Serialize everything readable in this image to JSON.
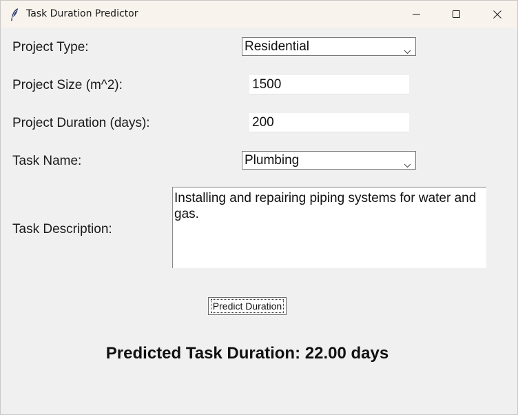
{
  "window": {
    "title": "Task Duration Predictor",
    "controls": [
      "minimize-icon",
      "maximize-icon",
      "close-icon"
    ]
  },
  "form": {
    "project_type": {
      "label": "Project Type:",
      "value": "Residential"
    },
    "project_size": {
      "label": "Project Size (m^2):",
      "value": "1500"
    },
    "project_duration": {
      "label": "Project Duration (days):",
      "value": "200"
    },
    "task_name": {
      "label": "Task Name:",
      "value": "Plumbing"
    },
    "task_description": {
      "label": "Task Description:",
      "value": "Installing and repairing piping systems for water and gas."
    }
  },
  "predict_button": {
    "label": "Predict Duration"
  },
  "result": {
    "text": "Predicted Task Duration: 22.00 days"
  },
  "colors": {
    "background": "#f0f0f0",
    "titlebar": "#f8f3ec",
    "field": "#ffffff"
  }
}
